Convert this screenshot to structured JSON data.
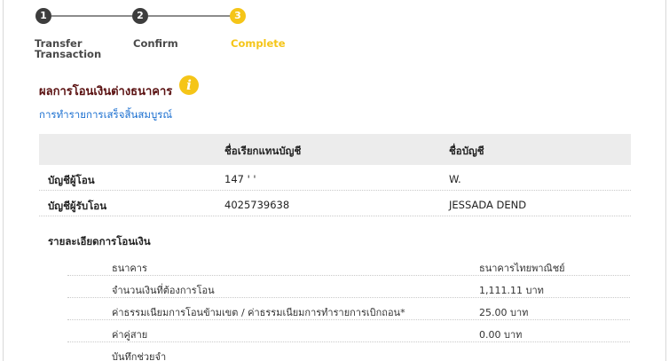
{
  "stepper": {
    "steps": [
      {
        "number": "1",
        "label_line1": "Transfer",
        "label_line2": "Transaction"
      },
      {
        "number": "2",
        "label_line1": "Confirm",
        "label_line2": ""
      },
      {
        "number": "3",
        "label_line1": "Complete",
        "label_line2": ""
      }
    ],
    "active_color": "#f5c518",
    "done_color": "#3d3d3d"
  },
  "result": {
    "title": "ผลการโอนเงินต่างธนาคาร",
    "info_icon": "i",
    "status": "การทำรายการเสร็จสิ้นสมบูรณ์"
  },
  "accounts": {
    "headers": [
      "",
      "ชื่อเรียกแทนบัญชี",
      "ชื่อบัญชี"
    ],
    "rows": [
      {
        "label": "บัญชีผู้โอน",
        "nickname": "147 ' ' ",
        "name": "W. "
      },
      {
        "label": "บัญชีผู้รับโอน",
        "nickname": "4025739638",
        "name": "JESSADA DEND"
      }
    ]
  },
  "details": {
    "title": "รายละเอียดการโอนเงิน",
    "rows": [
      {
        "label": "ธนาคาร",
        "value": "ธนาคารไทยพาณิชย์",
        "required": false
      },
      {
        "label": "จำนวนเงินที่ต้องการโอน",
        "value": "1,111.11 บาท",
        "required": false
      },
      {
        "label": "ค่าธรรมเนียมการโอนข้ามเขต / ค่าธรรมเนียมการทำรายการเบิกถอน",
        "value": "25.00 บาท",
        "required": true
      },
      {
        "label": "ค่าคู่สาย",
        "value": "0.00 บาท",
        "required": false
      },
      {
        "label": "บันทึกช่วยจำ",
        "value": "",
        "required": false
      }
    ],
    "required_mark": "*"
  }
}
